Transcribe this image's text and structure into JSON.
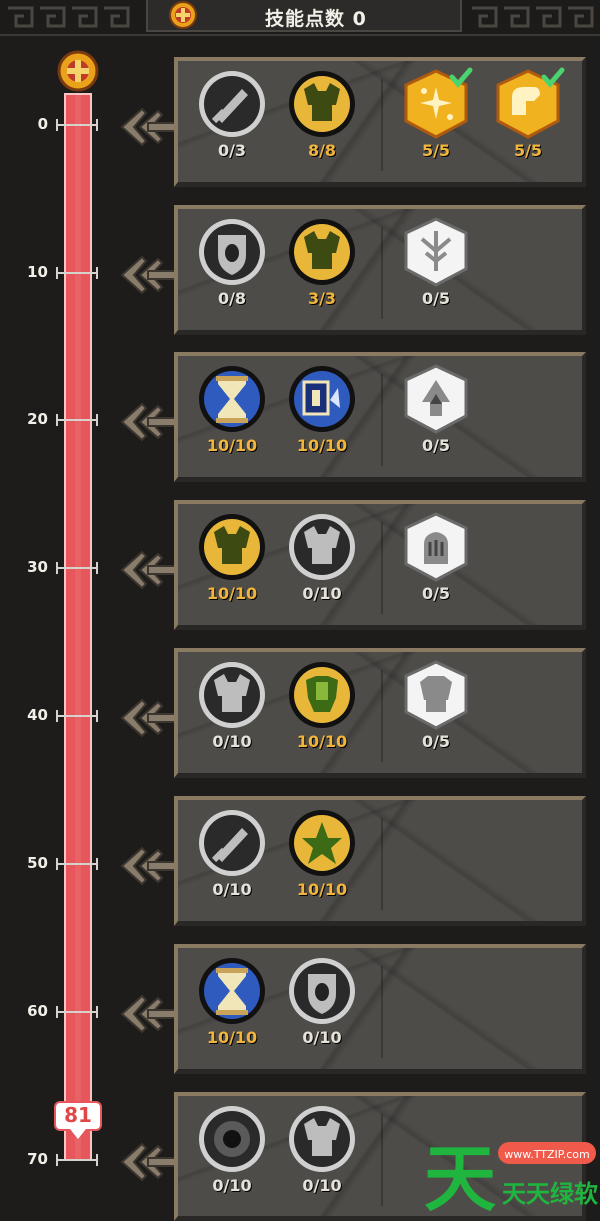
{
  "header": {
    "title": "技能点数 0"
  },
  "track": {
    "ticks": [
      "0",
      "10",
      "20",
      "30",
      "40",
      "50",
      "60",
      "70"
    ],
    "current_level": "81"
  },
  "tiers": [
    {
      "skills": [
        {
          "icon": "sword-icon",
          "style": "gray",
          "count": "0/3"
        },
        {
          "icon": "armor-icon",
          "style": "gold",
          "count": "8/8"
        },
        {
          "icon": "gold-hex-sparkle-icon",
          "style": "gold-hex",
          "count": "5/5",
          "checked": true
        },
        {
          "icon": "gold-hex-arm-icon",
          "style": "gold-hex",
          "count": "5/5",
          "checked": true
        }
      ]
    },
    {
      "skills": [
        {
          "icon": "shield-icon",
          "style": "gray",
          "count": "0/8"
        },
        {
          "icon": "armor-icon",
          "style": "gold",
          "count": "3/3"
        },
        {
          "icon": "white-hex-tree-icon",
          "style": "white-hex",
          "count": "0/5"
        }
      ]
    },
    {
      "skills": [
        {
          "icon": "hourglass-icon",
          "style": "blue",
          "count": "10/10"
        },
        {
          "icon": "blue-gem-icon",
          "style": "blue",
          "count": "10/10"
        },
        {
          "icon": "white-hex-arrow-icon",
          "style": "white-hex",
          "count": "0/5"
        }
      ]
    },
    {
      "skills": [
        {
          "icon": "armor-icon",
          "style": "gold",
          "count": "10/10"
        },
        {
          "icon": "armor-icon",
          "style": "gray",
          "count": "0/10"
        },
        {
          "icon": "white-hex-hand-icon",
          "style": "white-hex",
          "count": "0/5"
        }
      ]
    },
    {
      "skills": [
        {
          "icon": "armor-icon",
          "style": "gray",
          "count": "0/10"
        },
        {
          "icon": "green-armor-icon",
          "style": "gold",
          "count": "10/10"
        },
        {
          "icon": "white-hex-armor-icon",
          "style": "white-hex",
          "count": "0/5"
        }
      ]
    },
    {
      "skills": [
        {
          "icon": "sword-icon",
          "style": "gray",
          "count": "0/10"
        },
        {
          "icon": "green-star-icon",
          "style": "gold",
          "count": "10/10"
        }
      ]
    },
    {
      "skills": [
        {
          "icon": "hourglass-icon",
          "style": "blue",
          "count": "10/10"
        },
        {
          "icon": "shield-icon",
          "style": "gray",
          "count": "0/10"
        }
      ]
    },
    {
      "skills": [
        {
          "icon": "dark-orb-icon",
          "style": "gray",
          "count": "0/10"
        },
        {
          "icon": "armor-icon",
          "style": "gray",
          "count": "0/10"
        }
      ]
    }
  ],
  "watermark": {
    "site": "www.TTZIP.com",
    "brand": "天天绿软"
  },
  "colors": {
    "track": "#e6565a",
    "gold_text": "#f0b53a",
    "panel": "#4e4c49",
    "check": "#4ad36e"
  }
}
